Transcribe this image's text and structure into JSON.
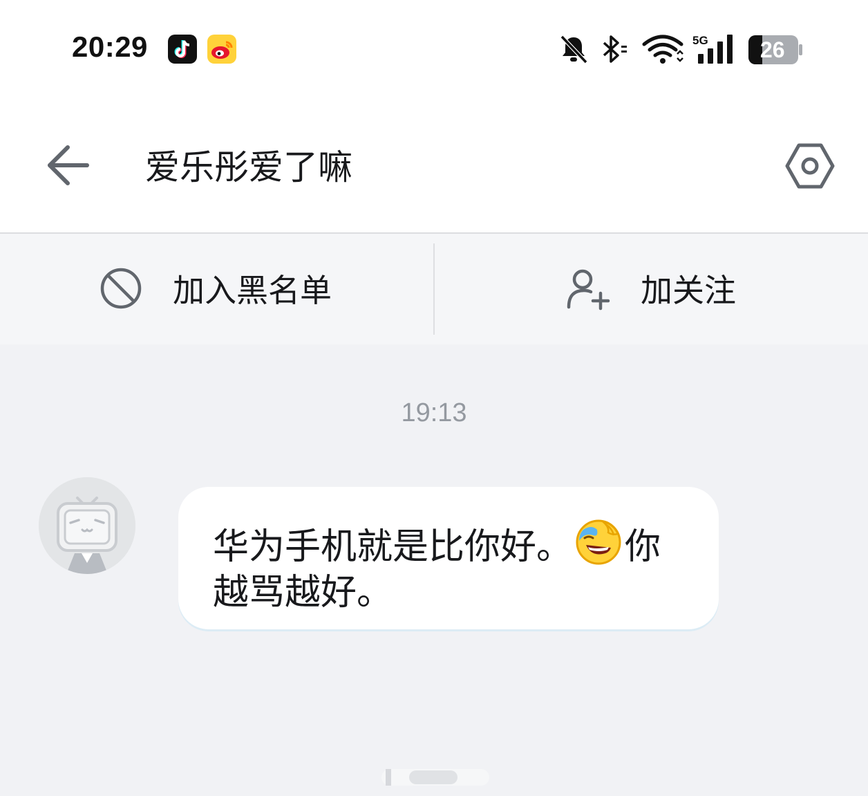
{
  "status_bar": {
    "time": "20:29",
    "apps": [
      "tiktok-icon",
      "weibo-icon"
    ],
    "network": "5G",
    "battery": "26"
  },
  "header": {
    "title": "爱乐彤爱了嘛",
    "back_icon": "arrow-left-icon",
    "settings_icon": "hexagon-settings-icon"
  },
  "actions": {
    "block_label": "加入黑名单",
    "follow_label": "加关注"
  },
  "chat": {
    "timestamp": "19:13",
    "message": {
      "text_before_emoji": "华为手机就是比你好。",
      "emoji": "laughing-face-emoji",
      "text_after_emoji": "你越骂越好。"
    }
  },
  "colors": {
    "background": "#f1f2f5",
    "header_bg": "#ffffff",
    "action_bar_bg": "#f5f6f8",
    "icon_gray": "#61666d",
    "timestamp_gray": "#9499a0"
  }
}
